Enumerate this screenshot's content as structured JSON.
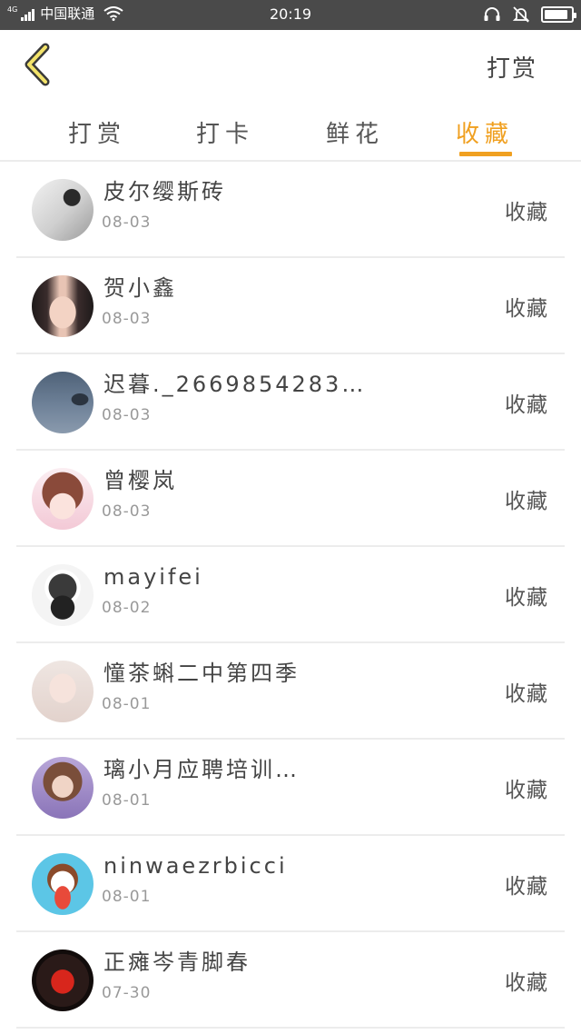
{
  "status_bar": {
    "network": "4G",
    "carrier": "中国联通",
    "time": "20:19",
    "battery_level": 0.9
  },
  "header": {
    "back_icon": "chevron-left-icon",
    "action_label": "打赏",
    "accent_color": "#f0a020"
  },
  "tabs": [
    {
      "label": "打赏",
      "active": false
    },
    {
      "label": "打卡",
      "active": false
    },
    {
      "label": "鲜花",
      "active": false
    },
    {
      "label": "收藏",
      "active": true
    }
  ],
  "list": {
    "items": [
      {
        "name": "皮尔缨斯砖",
        "date": "08-03",
        "action": "收藏"
      },
      {
        "name": "贺小鑫",
        "date": "08-03",
        "action": "收藏"
      },
      {
        "name": "迟暮._2669854283…",
        "date": "08-03",
        "action": "收藏"
      },
      {
        "name": "曾樱岚",
        "date": "08-03",
        "action": "收藏"
      },
      {
        "name": "mayifei",
        "date": "08-02",
        "action": "收藏"
      },
      {
        "name": "憧茶蝌二中第四季",
        "date": "08-01",
        "action": "收藏"
      },
      {
        "name": "璃小月应聘培训…",
        "date": "08-01",
        "action": "收藏"
      },
      {
        "name": "ninwaezrbicci",
        "date": "08-01",
        "action": "收藏"
      },
      {
        "name": "正瘫岑青脚春",
        "date": "07-30",
        "action": "收藏"
      }
    ]
  }
}
